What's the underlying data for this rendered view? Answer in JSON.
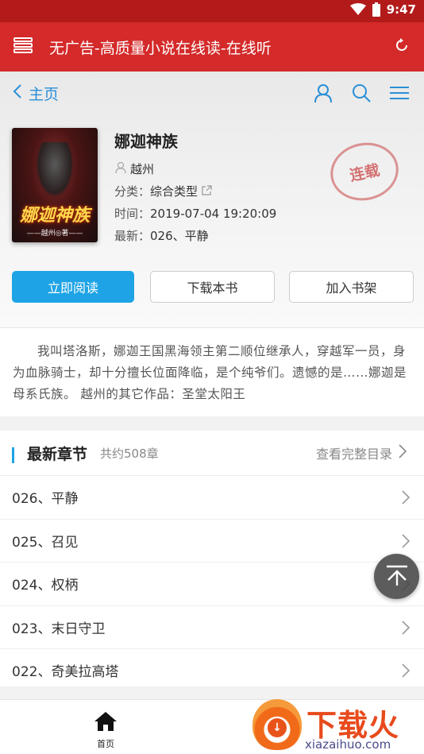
{
  "status_bar": {
    "time": "9:47"
  },
  "app_bar": {
    "title": "无广告-高质量小说在线读-在线听"
  },
  "nav": {
    "back_label": "主页"
  },
  "book": {
    "title": "娜迦神族",
    "author": "越州",
    "category_label": "分类：",
    "category_value": "综合类型",
    "time_label": "时间：",
    "time_value": "2019-07-04 19:20:09",
    "latest_label": "最新：",
    "latest_value": "026、平静",
    "status_stamp": "连载",
    "cover_title": "娜迦神族",
    "cover_author": "——越州◎著——"
  },
  "actions": {
    "read": "立即阅读",
    "download": "下载本书",
    "shelf": "加入书架"
  },
  "summary": "我叫塔洛斯，娜迦王国黑海领主第二顺位继承人，穿越军一员，身为血脉骑士，却十分擅长位面降临，是个纯爷们。遗憾的是……娜迦是母系氏族。 越州的其它作品：圣堂太阳王",
  "chapters": {
    "heading": "最新章节",
    "count": "共约508章",
    "more": "查看完整目录",
    "items": [
      "026、平静",
      "025、召见",
      "024、权柄",
      "023、末日守卫",
      "022、奇美拉高塔"
    ]
  },
  "bottom_nav": {
    "home": "首页"
  },
  "watermark": {
    "brand": "下载火",
    "url": "xiazaihuo.com"
  },
  "colors": {
    "app_bar": "#d42a2a",
    "status_bar": "#b31b1b",
    "accent": "#1ea4e6"
  }
}
